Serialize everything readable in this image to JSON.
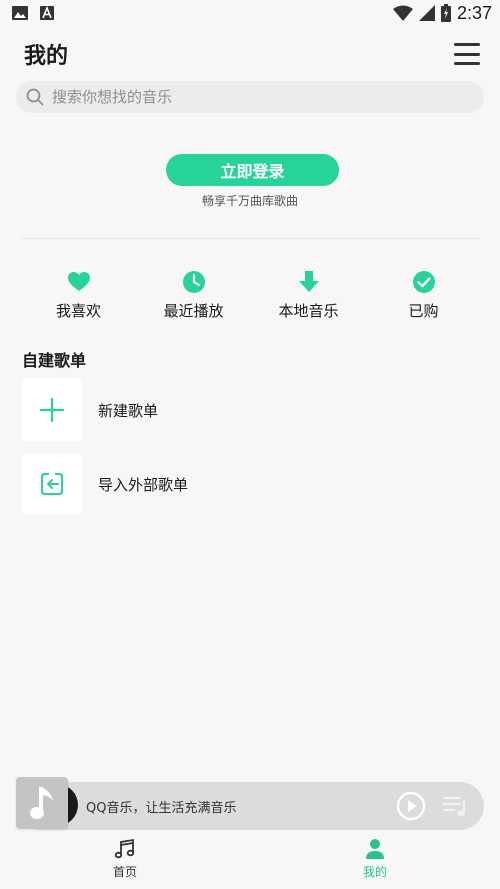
{
  "colors": {
    "accent": "#26d39b",
    "tab_active": "#26c48e",
    "background": "#f7f7f7",
    "search_bg": "#ececec"
  },
  "status_bar": {
    "time": "2:37",
    "icons": [
      "image-icon",
      "text-a-icon",
      "wifi-icon",
      "signal-icon",
      "battery-icon"
    ]
  },
  "header": {
    "title": "我的",
    "menu_icon": "menu-icon"
  },
  "search": {
    "placeholder": "搜索你想找的音乐",
    "icon": "search-icon"
  },
  "login": {
    "button_label": "立即登录",
    "subtitle": "畅享千万曲库歌曲"
  },
  "quick_actions": [
    {
      "label": "我喜欢",
      "icon": "heart-icon"
    },
    {
      "label": "最近播放",
      "icon": "clock-icon"
    },
    {
      "label": "本地音乐",
      "icon": "download-arrow-icon"
    },
    {
      "label": "已购",
      "icon": "check-circle-icon"
    }
  ],
  "playlists": {
    "section_title": "自建歌单",
    "items": [
      {
        "label": "新建歌单",
        "icon": "plus-icon"
      },
      {
        "label": "导入外部歌单",
        "icon": "import-icon"
      }
    ]
  },
  "player": {
    "title": "QQ音乐，让生活充满音乐",
    "play_icon": "play-icon",
    "playlist_icon": "playlist-icon"
  },
  "tabbar": {
    "tabs": [
      {
        "label": "首页",
        "icon": "music-note-icon",
        "active": false
      },
      {
        "label": "我的",
        "icon": "person-icon",
        "active": true
      }
    ]
  }
}
